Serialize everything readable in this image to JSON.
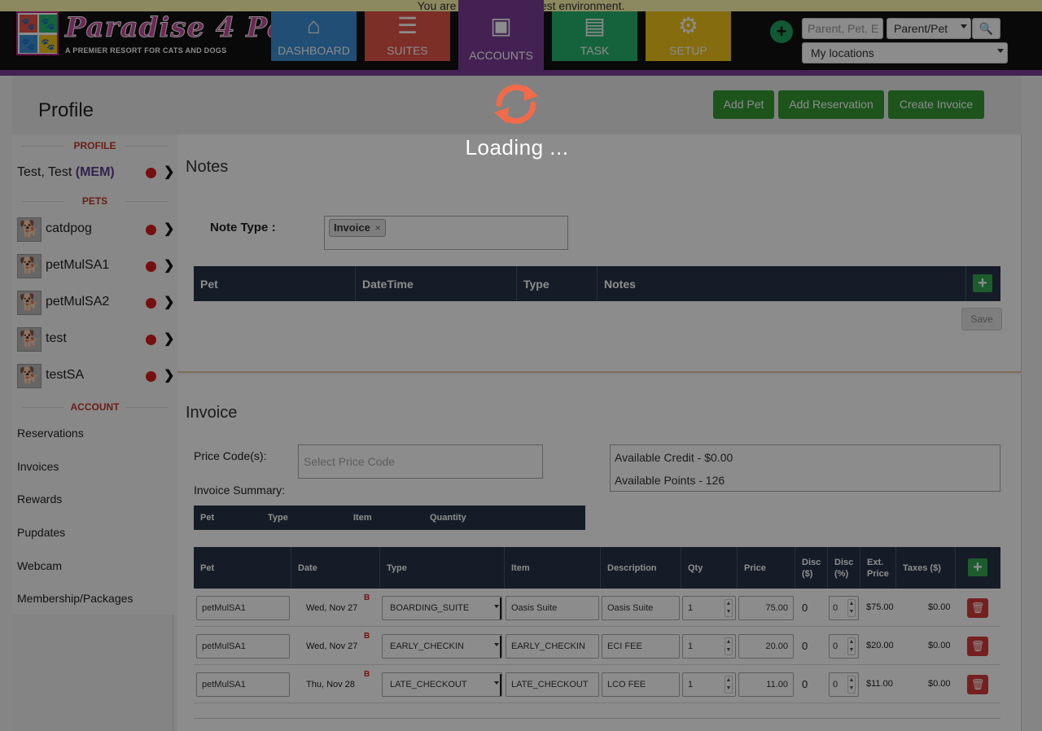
{
  "env_banner": "You are currently in the test environment.",
  "brand": {
    "title": "Paradise 4 Paws",
    "subtitle": "A PREMIER RESORT FOR CATS AND DOGS"
  },
  "nav": [
    {
      "label": "DASHBOARD",
      "icon": "tag-house-icon",
      "color": "#3b8fd4"
    },
    {
      "label": "SUITES",
      "icon": "list-icon",
      "color": "#e25548"
    },
    {
      "label": "ACCOUNTS",
      "icon": "id-card-icon",
      "color": "#7b3f98"
    },
    {
      "label": "TASK",
      "icon": "clipboard-icon",
      "color": "#27b56f"
    },
    {
      "label": "SETUP",
      "icon": "gears-icon",
      "color": "#f0c51c"
    }
  ],
  "search": {
    "placeholder": "Parent, Pet, E",
    "mode": "Parent/Pet",
    "location": "My locations"
  },
  "page": {
    "title": "Profile",
    "actions": [
      "Add Pet",
      "Add Reservation",
      "Create Invoice"
    ]
  },
  "loading": "Loading ...",
  "sidebar": {
    "profile_head": "PROFILE",
    "profile_name": "Test, Test",
    "profile_tag": "(MEM)",
    "pets_head": "PETS",
    "pets": [
      "catdpog",
      "petMulSA1",
      "petMulSA2",
      "test",
      "testSA"
    ],
    "account_head": "ACCOUNT",
    "account_links": [
      "Reservations",
      "Invoices",
      "Rewards",
      "Pupdates",
      "Webcam",
      "Membership/Packages"
    ]
  },
  "notes": {
    "title": "Notes",
    "type_label": "Note Type :",
    "type_tag": "Invoice",
    "columns": [
      "Pet",
      "DateTime",
      "Type",
      "Notes"
    ],
    "save": "Save"
  },
  "invoice": {
    "title": "Invoice",
    "price_code_label": "Price Code(s):",
    "price_code_placeholder": "Select Price Code",
    "summary_label": "Invoice Summary:",
    "credit": "Available Credit - $0.00",
    "points": "Available Points - 126",
    "summary_columns": [
      "Pet",
      "Type",
      "Item",
      "Quantity"
    ],
    "columns": [
      "Pet",
      "Date",
      "Type",
      "Item",
      "Description",
      "Qty",
      "Price",
      "Disc ($)",
      "Disc (%)",
      "Ext. Price",
      "Taxes ($)"
    ],
    "rows": [
      {
        "pet": "petMulSA1",
        "date": "Wed, Nov 27",
        "flag": "B",
        "type": "BOARDING_SUITE",
        "item": "Oasis Suite",
        "desc": "Oasis Suite",
        "qty": "1",
        "price": "75.00",
        "disc": "0",
        "discp": "0",
        "ext": "$75.00",
        "tax": "$0.00"
      },
      {
        "pet": "petMulSA1",
        "date": "Wed, Nov 27",
        "flag": "B",
        "type": "EARLY_CHECKIN",
        "item": "EARLY_CHECKIN",
        "desc": "ECI FEE",
        "qty": "1",
        "price": "20.00",
        "disc": "0",
        "discp": "0",
        "ext": "$20.00",
        "tax": "$0.00"
      },
      {
        "pet": "petMulSA1",
        "date": "Thu, Nov 28",
        "flag": "B",
        "type": "LATE_CHECKOUT",
        "item": "LATE_CHECKOUT",
        "desc": "LCO FEE",
        "qty": "1",
        "price": "11.00",
        "disc": "0",
        "discp": "0",
        "ext": "$11.00",
        "tax": "$0.00"
      }
    ]
  }
}
